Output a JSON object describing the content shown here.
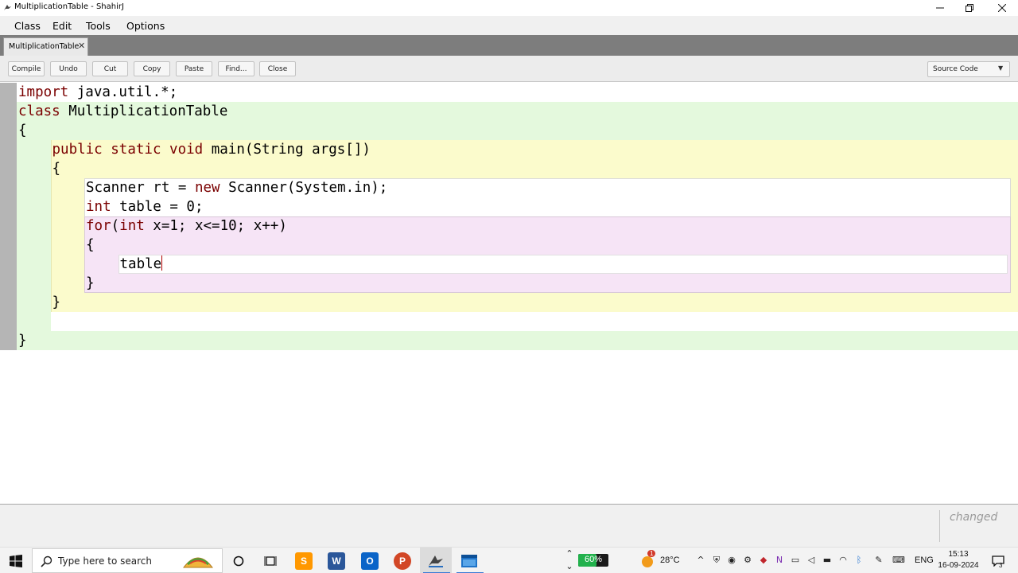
{
  "window": {
    "title": "MultiplicationTable - ShahirJ"
  },
  "menu": [
    "Class",
    "Edit",
    "Tools",
    "Options"
  ],
  "tab": {
    "label": "MultiplicationTable"
  },
  "toolbar": {
    "buttons": [
      "Compile",
      "Undo",
      "Cut",
      "Copy",
      "Paste",
      "Find...",
      "Close"
    ],
    "view_select": "Source Code"
  },
  "code": {
    "lines": [
      {
        "indent": 0,
        "parts": [
          {
            "t": "import",
            "k": true
          },
          {
            "t": " java.util.*;"
          }
        ]
      },
      {
        "indent": 0,
        "parts": [
          {
            "t": "class",
            "k": true
          },
          {
            "t": " MultiplicationTable"
          }
        ]
      },
      {
        "indent": 0,
        "parts": [
          {
            "t": "{"
          }
        ]
      },
      {
        "indent": 1,
        "parts": [
          {
            "t": "public",
            "k": true
          },
          {
            "t": " "
          },
          {
            "t": "static",
            "k": true
          },
          {
            "t": " "
          },
          {
            "t": "void",
            "k": true
          },
          {
            "t": " main(String args[])"
          }
        ]
      },
      {
        "indent": 1,
        "parts": [
          {
            "t": "{"
          }
        ]
      },
      {
        "indent": 2,
        "parts": [
          {
            "t": "Scanner rt = "
          },
          {
            "t": "new",
            "k": true
          },
          {
            "t": " Scanner(System.in);"
          }
        ]
      },
      {
        "indent": 2,
        "parts": [
          {
            "t": "int",
            "k": true
          },
          {
            "t": " table = 0;"
          }
        ]
      },
      {
        "indent": 2,
        "parts": [
          {
            "t": "for",
            "k": true
          },
          {
            "t": "("
          },
          {
            "t": "int",
            "k": true
          },
          {
            "t": " x=1; x<=10; x++)"
          }
        ]
      },
      {
        "indent": 2,
        "parts": [
          {
            "t": "{"
          }
        ]
      },
      {
        "indent": 3,
        "parts": [
          {
            "t": "table"
          }
        ],
        "caret": true
      },
      {
        "indent": 2,
        "parts": [
          {
            "t": "}"
          }
        ]
      },
      {
        "indent": 1,
        "parts": [
          {
            "t": "}"
          }
        ]
      },
      {
        "indent": 1,
        "parts": [
          {
            "t": ""
          }
        ]
      },
      {
        "indent": 0,
        "parts": [
          {
            "t": "}"
          }
        ]
      }
    ]
  },
  "status": {
    "text": "changed"
  },
  "taskbar": {
    "search_placeholder": "Type here to search",
    "battery_percent": 60,
    "battery_label": "60%",
    "weather_badge": "1",
    "temperature": "28°C",
    "language": "ENG",
    "time": "15:13",
    "date": "16-09-2024",
    "notification_count": "3"
  },
  "colors": {
    "keyword": "#7a0000",
    "class_scope": "#e4f9dd",
    "method_scope": "#fbfbcc",
    "loop_scope": "#f6e4f6",
    "taskbar_accent": "#3a7bd5"
  }
}
